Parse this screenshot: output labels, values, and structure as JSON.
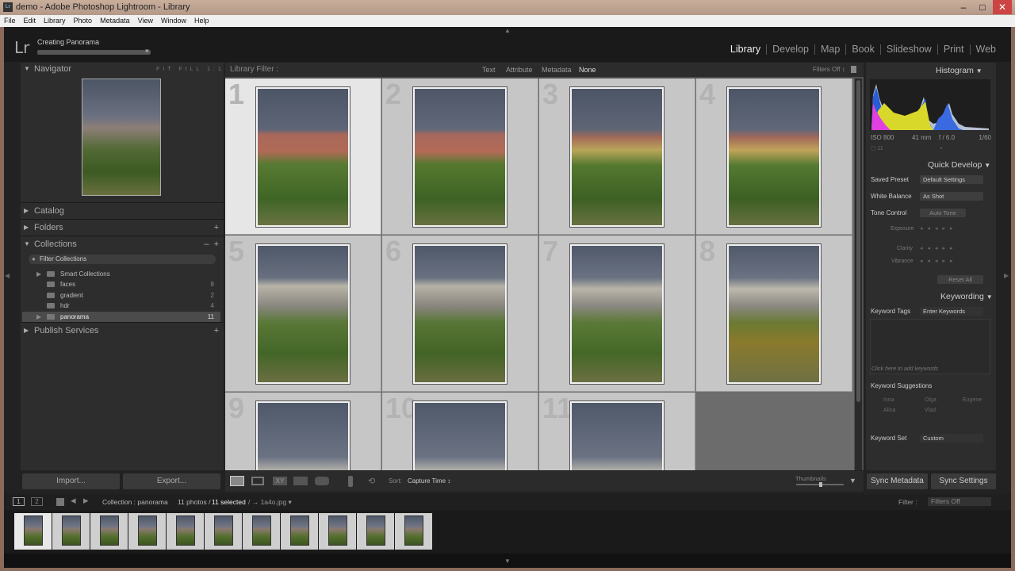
{
  "window": {
    "title": "demo - Adobe Photoshop Lightroom - Library",
    "minimize": "–",
    "maximize": "□",
    "close": "✕"
  },
  "menu": [
    "File",
    "Edit",
    "Library",
    "Photo",
    "Metadata",
    "View",
    "Window",
    "Help"
  ],
  "header": {
    "logo": "Lr",
    "activity": "Creating Panorama",
    "activity_close": "×"
  },
  "modules": [
    "Library",
    "Develop",
    "Map",
    "Book",
    "Slideshow",
    "Print",
    "Web"
  ],
  "left": {
    "navigator": "Navigator",
    "nav_options": "FIT FILL 1:1 1:8",
    "catalog": "Catalog",
    "folders": "Folders",
    "collections": "Collections",
    "filter_collections": "Filter Collections",
    "items": [
      {
        "label": "Smart Collections",
        "count": ""
      },
      {
        "label": "faces",
        "count": "8"
      },
      {
        "label": "gradient",
        "count": "2"
      },
      {
        "label": "hdr",
        "count": "4"
      },
      {
        "label": "panorama",
        "count": "11"
      }
    ],
    "publish": "Publish Services",
    "import": "Import...",
    "export": "Export..."
  },
  "filterbar": {
    "label": "Library Filter :",
    "opts": [
      "Text",
      "Attribute",
      "Metadata",
      "None"
    ],
    "filters_off": "Filters Off ↕"
  },
  "grid": {
    "numbers": [
      "1",
      "2",
      "3",
      "4",
      "5",
      "6",
      "7",
      "8",
      "9",
      "10",
      "11"
    ]
  },
  "toolbar": {
    "sort_label": "Sort:",
    "sort_value": "Capture Time ↕",
    "thumbs": "Thumbnails"
  },
  "right": {
    "histogram": "Histogram",
    "iso": "ISO 800",
    "focal": "41 mm",
    "fstop": "f / 6.0",
    "shutter": "1/60",
    "quick_develop": "Quick Develop",
    "saved_preset": "Saved Preset",
    "saved_preset_val": "Default Settings",
    "white_balance": "White Balance",
    "white_balance_val": "As Shot",
    "tone_control": "Tone Control",
    "auto_tone": "Auto Tone",
    "exposure": "Exposure",
    "clarity": "Clarity",
    "vibrance": "Vibrance",
    "reset_all": "Reset All",
    "keywording": "Keywording",
    "keyword_tags": "Keyword Tags",
    "enter_keywords": "Enter Keywords",
    "click_add": "Click here to add keywords",
    "suggestions": "Keyword Suggestions",
    "sugg": [
      "Inna",
      "Olga",
      "Eugene",
      "Alina",
      "Vlad"
    ],
    "keyword_set": "Keyword Set",
    "keyword_set_val": "Custom",
    "sync_metadata": "Sync Metadata",
    "sync_settings": "Sync Settings"
  },
  "filmstrip": {
    "collection": "Collection : panorama",
    "count": "11 photos /",
    "selected": "11 selected",
    "file": "/ → 1a4o.jpg ▾",
    "filter_label": "Filter :",
    "filter_val": "Filters Off"
  }
}
